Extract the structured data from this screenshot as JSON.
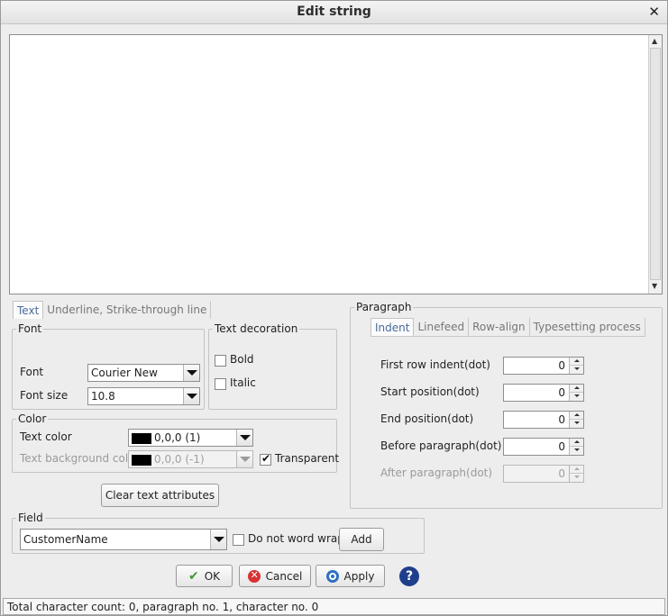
{
  "window": {
    "title": "Edit string"
  },
  "left_tabs": [
    "Text",
    "Underline, Strike-through line"
  ],
  "font_group": {
    "legend": "Font",
    "font_label": "Font",
    "font_value": "Courier New",
    "size_label": "Font size",
    "size_value": "10.8"
  },
  "decoration": {
    "legend": "Text decoration",
    "bold": "Bold",
    "italic": "Italic"
  },
  "color_group": {
    "legend": "Color",
    "text_color_label": "Text color",
    "text_color_value": "0,0,0 (1)",
    "bg_color_label": "Text background color",
    "bg_color_value": "0,0,0 (-1)",
    "transparent_label": "Transparent",
    "swatch_color": "#000000"
  },
  "clear_button": "Clear text attributes",
  "paragraph": {
    "legend": "Paragraph",
    "tabs": [
      "Indent",
      "Linefeed",
      "Row-align",
      "Typesetting process"
    ],
    "rows": [
      {
        "label": "First row indent(dot)",
        "value": "0"
      },
      {
        "label": "Start position(dot)",
        "value": "0"
      },
      {
        "label": "End position(dot)",
        "value": "0"
      },
      {
        "label": "Before paragraph(dot)",
        "value": "0"
      },
      {
        "label": "After paragraph(dot)",
        "value": "0"
      }
    ]
  },
  "field": {
    "legend": "Field",
    "value": "CustomerName",
    "no_wrap_label": "Do not word wrap",
    "add_label": "Add"
  },
  "actions": {
    "ok": "OK",
    "cancel": "Cancel",
    "apply": "Apply",
    "help": "?"
  },
  "status": "Total character count: 0, paragraph no. 1, character no. 0"
}
